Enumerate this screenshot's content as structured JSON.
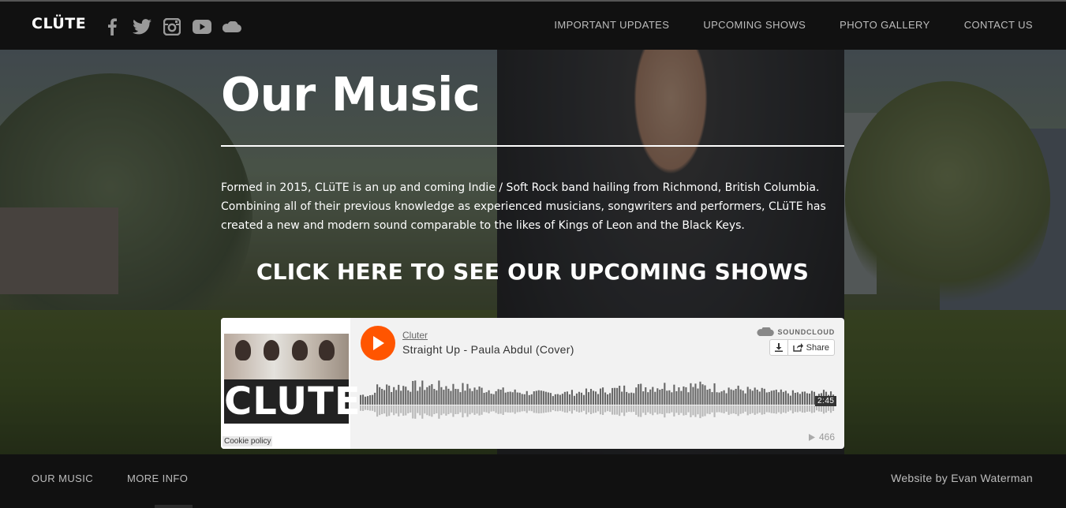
{
  "header": {
    "brand": "CLÜTE",
    "social": [
      "facebook-icon",
      "twitter-icon",
      "instagram-icon",
      "youtube-icon",
      "soundcloud-icon"
    ],
    "nav": [
      "IMPORTANT UPDATES",
      "UPCOMING SHOWS",
      "PHOTO GALLERY",
      "CONTACT US"
    ]
  },
  "hero": {
    "title": "Our Music",
    "description": "Formed in 2015, CLüTE is an up and coming Indie / Soft Rock band hailing from Richmond, British Columbia. Combining all of their previous knowledge as experienced musicians, songwriters and performers, CLüTE has created a new and modern sound comparable to the likes of Kings of Leon and the Black Keys.",
    "cta": "CLICK HERE TO SEE OUR UPCOMING SHOWS"
  },
  "player": {
    "artist": "Cluter",
    "track": "Straight Up - Paula Abdul (Cover)",
    "brand": "SOUNDCLOUD",
    "share_label": "Share",
    "duration": "2:45",
    "plays": "466",
    "artwork_text": "CLUTE",
    "cookie": "Cookie policy",
    "accent": "#ff5500"
  },
  "footer": {
    "nav": [
      "OUR MUSIC",
      "MORE INFO"
    ],
    "credit": "Website by Evan Waterman"
  }
}
